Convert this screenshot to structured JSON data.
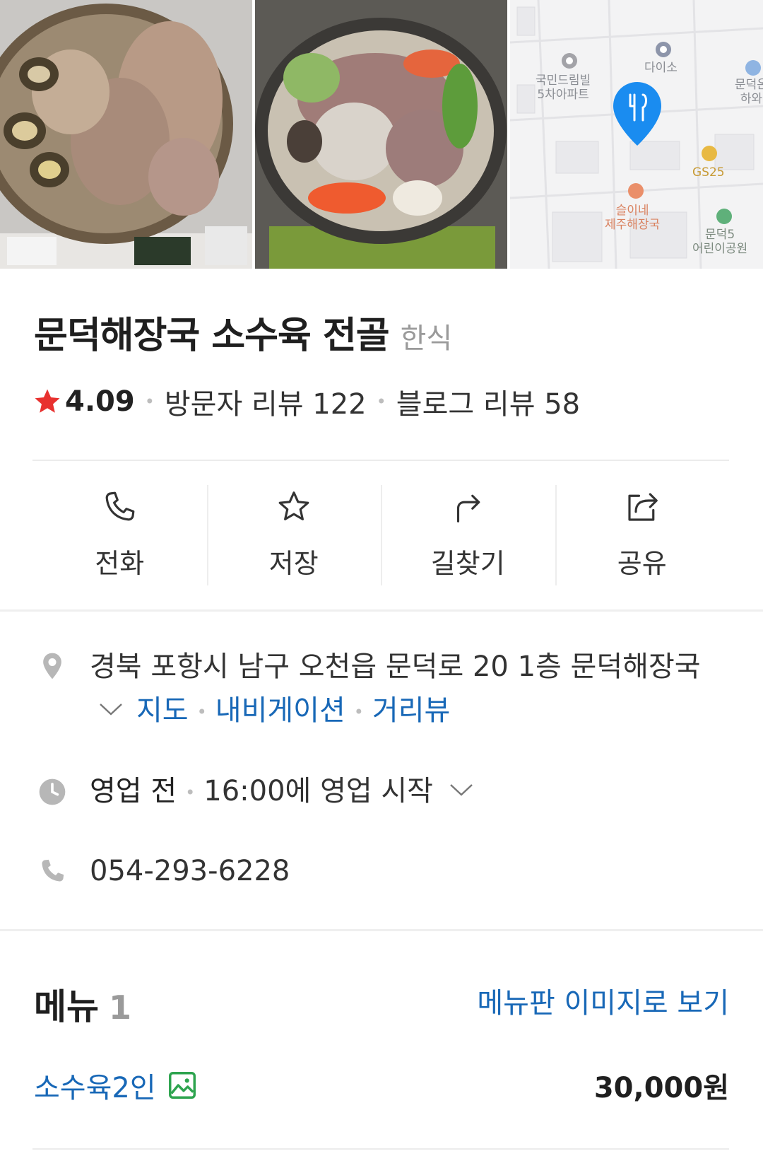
{
  "place": {
    "name": "문덕해장국 소수육 전골",
    "category": "한식",
    "rating": "4.09",
    "visitor_reviews": "방문자 리뷰 122",
    "blog_reviews": "블로그 리뷰 58"
  },
  "map": {
    "labels": {
      "apt": "국민드림빌\n5차아파트",
      "daiso": "다이소",
      "munduk": "문덕온\n하와",
      "gs25": "GS25",
      "seuline": "슬이네\n제주해장국",
      "park": "문덕5\n어린이공원"
    }
  },
  "actions": [
    {
      "label": "전화",
      "icon": "phone-icon"
    },
    {
      "label": "저장",
      "icon": "star-outline-icon"
    },
    {
      "label": "길찾기",
      "icon": "directions-icon"
    },
    {
      "label": "공유",
      "icon": "share-icon"
    }
  ],
  "address": {
    "text": "경북 포항시 남구 오천읍 문덕로 20 1층 문덕해장국",
    "map_link": "지도",
    "navi_link": "내비게이션",
    "street_link": "거리뷰"
  },
  "hours": {
    "status": "영업 전",
    "detail": "16:00에 영업 시작"
  },
  "phone": "054-293-6228",
  "menu": {
    "title": "메뉴",
    "count": "1",
    "image_link": "메뉴판 이미지로 보기",
    "items": [
      {
        "name": "소수육2인",
        "price": "30,000원"
      }
    ]
  },
  "colors": {
    "link": "#1868b7",
    "star": "#e8312f",
    "map_pin": "#1a8cf0"
  }
}
